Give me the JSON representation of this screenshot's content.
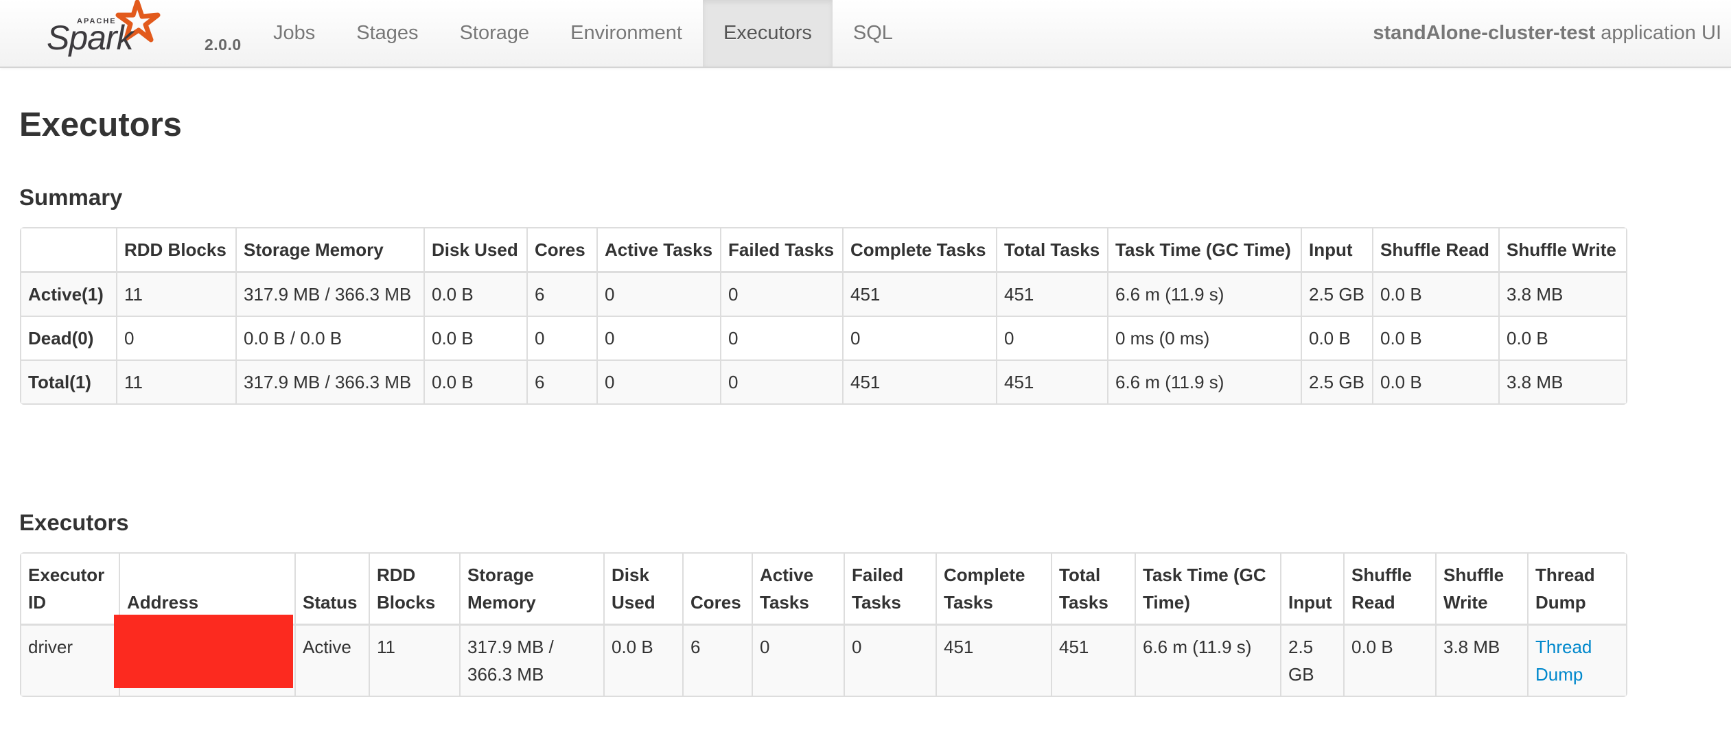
{
  "navbar": {
    "brand": "Apache Spark",
    "brand_small": "APACHE",
    "brand_word": "Spark",
    "version": "2.0.0",
    "tabs": [
      {
        "label": "Jobs",
        "active": false
      },
      {
        "label": "Stages",
        "active": false
      },
      {
        "label": "Storage",
        "active": false
      },
      {
        "label": "Environment",
        "active": false
      },
      {
        "label": "Executors",
        "active": true
      },
      {
        "label": "SQL",
        "active": false
      }
    ],
    "app_name": "standAlone-cluster-test",
    "app_suffix": "application UI"
  },
  "page_title": "Executors",
  "summary": {
    "title": "Summary",
    "headers": [
      "",
      "RDD Blocks",
      "Storage Memory",
      "Disk Used",
      "Cores",
      "Active Tasks",
      "Failed Tasks",
      "Complete Tasks",
      "Total Tasks",
      "Task Time (GC Time)",
      "Input",
      "Shuffle Read",
      "Shuffle Write"
    ],
    "rows": [
      [
        "Active(1)",
        "11",
        "317.9 MB / 366.3 MB",
        "0.0 B",
        "6",
        "0",
        "0",
        "451",
        "451",
        "6.6 m (11.9 s)",
        "2.5 GB",
        "0.0 B",
        "3.8 MB"
      ],
      [
        "Dead(0)",
        "0",
        "0.0 B / 0.0 B",
        "0.0 B",
        "0",
        "0",
        "0",
        "0",
        "0",
        "0 ms (0 ms)",
        "0.0 B",
        "0.0 B",
        "0.0 B"
      ],
      [
        "Total(1)",
        "11",
        "317.9 MB / 366.3 MB",
        "0.0 B",
        "6",
        "0",
        "0",
        "451",
        "451",
        "6.6 m (11.9 s)",
        "2.5 GB",
        "0.0 B",
        "3.8 MB"
      ]
    ]
  },
  "executors": {
    "title": "Executors",
    "headers": [
      "Executor ID",
      "Address",
      "Status",
      "RDD Blocks",
      "Storage Memory",
      "Disk Used",
      "Cores",
      "Active Tasks",
      "Failed Tasks",
      "Complete Tasks",
      "Total Tasks",
      "Task Time (GC Time)",
      "Input",
      "Shuffle Read",
      "Shuffle Write",
      "Thread Dump"
    ],
    "rows": [
      [
        "driver",
        "",
        "Active",
        "11",
        "317.9 MB / 366.3 MB",
        "0.0 B",
        "6",
        "0",
        "0",
        "451",
        "451",
        "6.6 m (11.9 s)",
        "2.5 GB",
        "0.0 B",
        "3.8 MB",
        "Thread Dump"
      ]
    ],
    "address_redacted": true
  },
  "colors": {
    "brand_orange": "#e25a1c",
    "brand_gray": "#3c3a3e",
    "link": "#0088cc",
    "redaction": "#fc2a1f",
    "text": "#333333",
    "nav_text": "#777777",
    "active_tab_bg": "#e5e5e5"
  }
}
